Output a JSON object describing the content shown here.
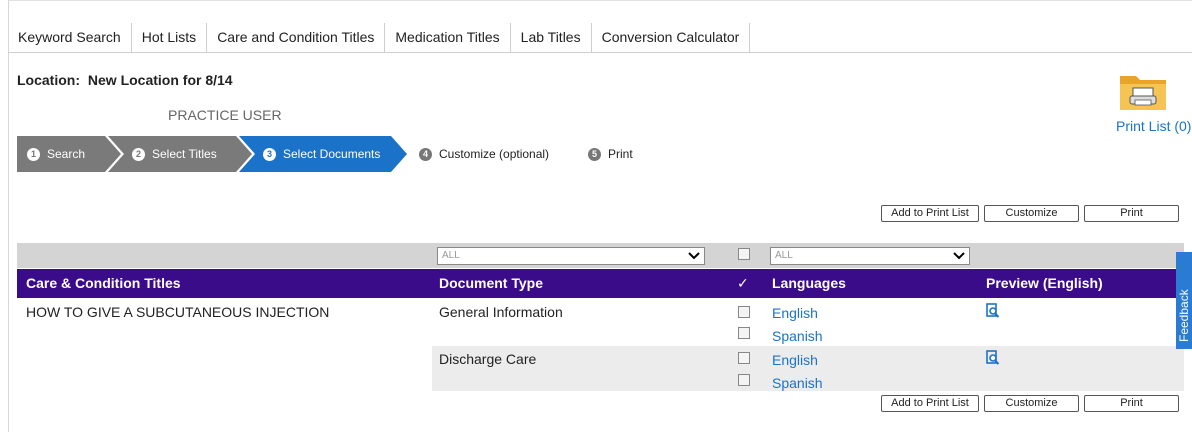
{
  "tabs": [
    "Keyword Search",
    "Hot Lists",
    "Care and Condition Titles",
    "Medication Titles",
    "Lab Titles",
    "Conversion Calculator"
  ],
  "location": {
    "label": "Location:",
    "value": "New Location for 8/14"
  },
  "user": "PRACTICE USER",
  "print_list": {
    "label": "Print List (0)",
    "icon": "folder-printer-icon"
  },
  "steps": [
    {
      "num": "1",
      "label": "Search",
      "state": "done"
    },
    {
      "num": "2",
      "label": "Select Titles",
      "state": "done"
    },
    {
      "num": "3",
      "label": "Select Documents",
      "state": "active"
    },
    {
      "num": "4",
      "label": "Customize (optional)",
      "state": "pending"
    },
    {
      "num": "5",
      "label": "Print",
      "state": "pending"
    }
  ],
  "buttons": {
    "add": "Add to Print List",
    "customize": "Customize",
    "print": "Print"
  },
  "filters": {
    "doc_type": "ALL",
    "language": "ALL"
  },
  "table": {
    "headers": {
      "title": "Care & Condition Titles",
      "doc_type": "Document Type",
      "check": "✓",
      "languages": "Languages",
      "preview": "Preview (English)"
    },
    "title": "HOW TO GIVE A SUBCUTANEOUS INJECTION",
    "rows": [
      {
        "doc_type": "General Information",
        "languages": [
          "English",
          "Spanish"
        ]
      },
      {
        "doc_type": "Discharge Care",
        "languages": [
          "English",
          "Spanish"
        ]
      }
    ]
  },
  "feedback": "Feedback",
  "colors": {
    "header": "#3a0c8a",
    "active_step": "#1a73c9",
    "done_step": "#7a7a7a",
    "link": "#1a73c9"
  }
}
